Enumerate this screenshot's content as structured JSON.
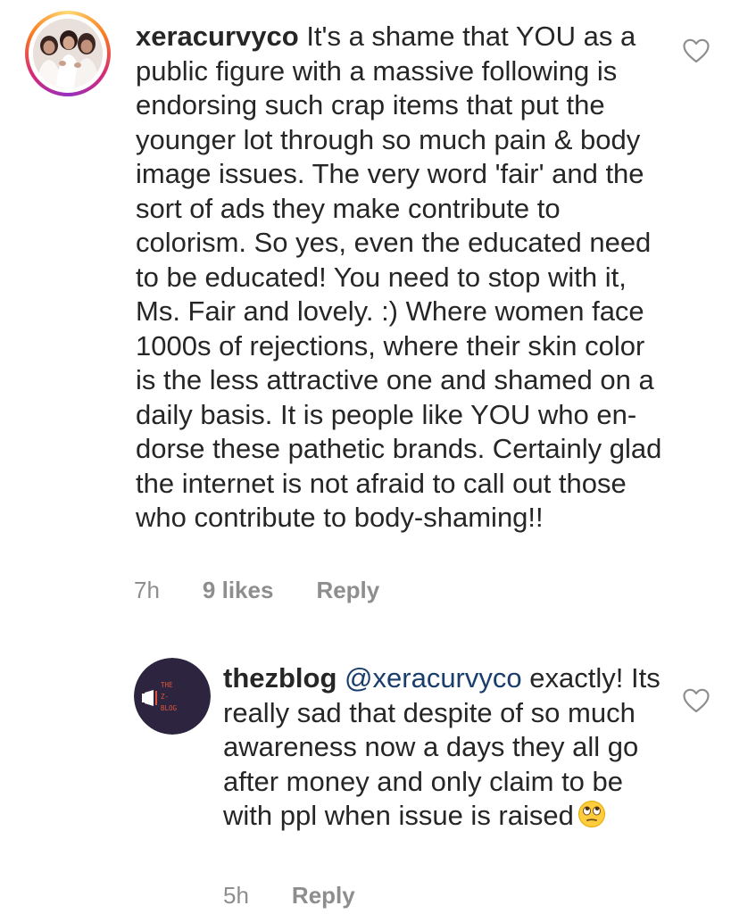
{
  "comments": [
    {
      "username": "xeracurvyco",
      "text": "It's a shame that YOU as a public figure with a massive following is endorsing such crap items that put the younger lot through so much pain & body image issues. The very word 'fair' and the sort of ads they make contribute to colorism. So yes, even the educated need to be educated! You need to stop with it, Ms. Fair and lovely. :) Where women face 1000s of rejections, where their skin color is the less attractive one and shamed on a daily basis. It is people like YOU who en-dorse these pathetic brands. Certainly glad the internet is not afraid to call out those who contribute to body-shaming!!",
      "time": "7h",
      "likes": "9 likes",
      "reply_label": "Reply",
      "avatar_icon": "group-photo-avatar",
      "like_icon": "heart-outline-icon"
    },
    {
      "username": "thezblog",
      "mention": "@xeracurvyco",
      "text": "exactly! Its really sad that despite of so much awareness now a days they all go after money and only claim to be with ppl when issue is raised",
      "emoji": "eye-roll-emoji",
      "time": "5h",
      "reply_label": "Reply",
      "avatar_icon": "the-z-blog-logo",
      "avatar_logo_lines": [
        "THE",
        "Z-",
        "BLOG"
      ],
      "like_icon": "heart-outline-icon"
    }
  ],
  "colors": {
    "text": "#262626",
    "meta": "#8e8e8e",
    "mention": "#1a3e6b",
    "logo_bg": "#2d2540",
    "logo_accent": "#e0553a"
  }
}
